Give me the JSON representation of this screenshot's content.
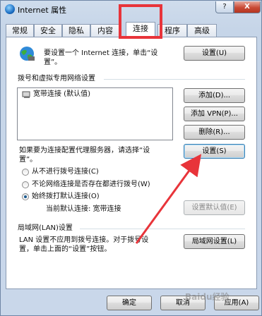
{
  "window": {
    "title": "Internet 属性",
    "help_label": "?",
    "close_label": "X"
  },
  "tabs": [
    {
      "label": "常规"
    },
    {
      "label": "安全"
    },
    {
      "label": "隐私"
    },
    {
      "label": "内容"
    },
    {
      "label": "连接",
      "active": true
    },
    {
      "label": "程序"
    },
    {
      "label": "高级"
    }
  ],
  "setup": {
    "text_line1": "要设置一个 Internet 连接，单击“设",
    "text_line2": "置”。",
    "button": "设置(U)"
  },
  "dialup": {
    "header": "拨号和虚拟专用网络设置",
    "connection_item": "宽带连接 (默认值)",
    "add_button": "添加(D)...",
    "add_vpn_button": "添加 VPN(P)...",
    "delete_button": "删除(R)...",
    "proxy_text_line1": "如果要为连接配置代理服务器，请选择“设",
    "proxy_text_line2": "置”。",
    "settings_button": "设置(S)",
    "radio_never": "从不进行拨号连接(C)",
    "radio_no_network": "不论网络连接是否存在都进行拨号(W)",
    "radio_always": "始终拨打默认连接(O)",
    "current_default": "当前默认连接: 宽带连接",
    "set_default_button": "设置默认值(E)"
  },
  "lan": {
    "header": "局域网(LAN)设置",
    "text_line1": "LAN 设置不应用到拨号连接。对于拨号设",
    "text_line2": "置，单击上面的“设置”按钮。",
    "button": "局域网设置(L)"
  },
  "footer": {
    "ok": "确定",
    "cancel": "取消",
    "apply": "应用(A)"
  },
  "annotation": {
    "highlight_color": "#e8343a",
    "arrow_color": "#e8343a"
  },
  "watermark": "Baidu经验"
}
